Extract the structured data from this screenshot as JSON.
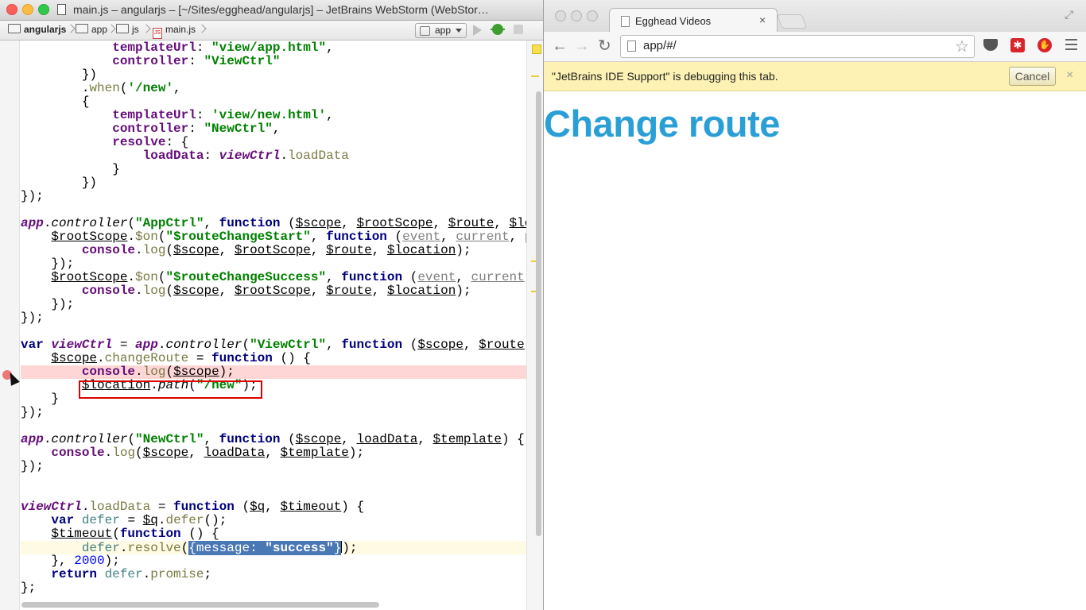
{
  "ide": {
    "title": "main.js – angularjs – [~/Sites/egghead/angularjs] – JetBrains WebStorm (WebStor…",
    "breadcrumb": [
      "angularjs",
      "app",
      "js",
      "main.js"
    ],
    "run_config": "app"
  },
  "code": {
    "l1": [
      "            ",
      "templateUrl",
      ": ",
      "\"view/app.html\"",
      ","
    ],
    "l2": [
      "            ",
      "controller",
      ": ",
      "\"ViewCtrl\""
    ],
    "l3": [
      "        })"
    ],
    "l4": [
      "        .",
      "when",
      "(",
      "'/new'",
      ","
    ],
    "l5": [
      "        {"
    ],
    "l6": [
      "            ",
      "templateUrl",
      ": ",
      "'view/new.html'",
      ","
    ],
    "l7": [
      "            ",
      "controller",
      ": ",
      "\"NewCtrl\"",
      ","
    ],
    "l8": [
      "            ",
      "resolve",
      ": {"
    ],
    "l9": [
      "                ",
      "loadData",
      ": ",
      "viewCtrl",
      ".",
      "loadData"
    ],
    "l10": [
      "            }"
    ],
    "l11": [
      "        })"
    ],
    "l12": [
      "});"
    ],
    "l13": [
      ""
    ],
    "l14": [
      "app",
      ".",
      "controller",
      "(",
      "\"AppCtrl\"",
      ", ",
      "function",
      " (",
      "$scope",
      ", ",
      "$rootScope",
      ", ",
      "$route",
      ", ",
      "$lo"
    ],
    "l15": [
      "    ",
      "$rootScope",
      ".",
      "$on",
      "(",
      "\"$routeChangeStart\"",
      ", ",
      "function",
      " (",
      "event",
      ", ",
      "current",
      ", ",
      "p"
    ],
    "l16": [
      "        ",
      "console",
      ".",
      "log",
      "(",
      "$scope",
      ", ",
      "$rootScope",
      ", ",
      "$route",
      ", ",
      "$location",
      ");"
    ],
    "l17": [
      "    });"
    ],
    "l18": [
      "    ",
      "$rootScope",
      ".",
      "$on",
      "(",
      "\"$routeChangeSuccess\"",
      ", ",
      "function",
      " (",
      "event",
      ", ",
      "current"
    ],
    "l19": [
      "        ",
      "console",
      ".",
      "log",
      "(",
      "$scope",
      ", ",
      "$rootScope",
      ", ",
      "$route",
      ", ",
      "$location",
      ");"
    ],
    "l20": [
      "    });"
    ],
    "l21": [
      "});"
    ],
    "l22": [
      ""
    ],
    "l23": [
      "var",
      " ",
      "viewCtrl",
      " = ",
      "app",
      ".",
      "controller",
      "(",
      "\"ViewCtrl\"",
      ", ",
      "function",
      " (",
      "$scope",
      ", ",
      "$route"
    ],
    "l24": [
      "    ",
      "$scope",
      ".",
      "changeRoute",
      " = ",
      "function",
      " () {"
    ],
    "l25": [
      "        ",
      "console",
      ".",
      "log",
      "(",
      "$scope",
      ");"
    ],
    "l26": [
      "        ",
      "$location",
      ".",
      "path",
      "(",
      "\"/new\"",
      ");"
    ],
    "l27": [
      "    }"
    ],
    "l28": [
      "});"
    ],
    "l29": [
      ""
    ],
    "l30": [
      "app",
      ".",
      "controller",
      "(",
      "\"NewCtrl\"",
      ", ",
      "function",
      " (",
      "$scope",
      ", ",
      "loadData",
      ", ",
      "$template",
      ") {"
    ],
    "l31": [
      "    ",
      "console",
      ".",
      "log",
      "(",
      "$scope",
      ", ",
      "loadData",
      ", ",
      "$template",
      ");"
    ],
    "l32": [
      "});"
    ],
    "l33": [
      ""
    ],
    "l34": [
      ""
    ],
    "l35": [
      "viewCtrl",
      ".",
      "loadData",
      " = ",
      "function",
      " (",
      "$q",
      ", ",
      "$timeout",
      ") {"
    ],
    "l36": [
      "    ",
      "var",
      " ",
      "defer",
      " = ",
      "$q",
      ".",
      "defer",
      "();"
    ],
    "l37": [
      "    ",
      "$timeout",
      "(",
      "function",
      " () {"
    ],
    "l38": [
      "        ",
      "defer",
      ".",
      "resolve",
      "(",
      "{message: ",
      "\"success\"",
      "}",
      ");"
    ],
    "l39": [
      "    }, ",
      "2000",
      ");"
    ],
    "l40": [
      "    ",
      "return",
      " ",
      "defer",
      ".",
      "promise",
      ";"
    ],
    "l41": [
      "};"
    ]
  },
  "browser": {
    "tab_title": "Egghead Videos",
    "tab_close": "×",
    "url": "app/#/",
    "infobar_text": "\"JetBrains IDE Support\" is debugging this tab.",
    "cancel_label": "Cancel",
    "infobar_close": "×",
    "page_heading": "Change route"
  },
  "icons": {
    "back": "←",
    "forward": "→",
    "reload": "↻",
    "star": "☆",
    "fullscreen": "⤢"
  },
  "colors": {
    "heading": "#2a9fd6",
    "breakpoint_line": "#ffd6d6",
    "highlight_box": "#e00000",
    "infobar": "#fdf2b3"
  }
}
